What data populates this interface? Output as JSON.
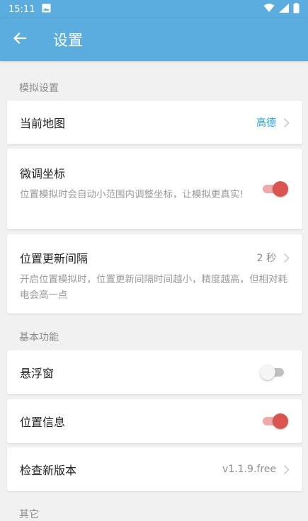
{
  "status_bar": {
    "time": "15:11"
  },
  "app_bar": {
    "title": "设置"
  },
  "sections": {
    "simulation": "模拟设置",
    "basic": "基本功能",
    "other": "其它"
  },
  "settings": {
    "current_map": {
      "title": "当前地图",
      "value": "高德"
    },
    "fine_tune": {
      "title": "微调坐标",
      "desc": "位置模拟时会自动小范围内调整坐标，让模拟更真实!",
      "enabled": true
    },
    "update_interval": {
      "title": "位置更新间隔",
      "value": "2 秒",
      "desc": "开启位置模拟时，位置更新间隔时间越小，精度越高，但相对耗电会高一点"
    },
    "floating_window": {
      "title": "悬浮窗",
      "enabled": false
    },
    "location_info": {
      "title": "位置信息",
      "enabled": true
    },
    "check_update": {
      "title": "检查新版本",
      "value": "v1.1.9.free"
    }
  },
  "colors": {
    "primary": "#5aadde",
    "accent_text": "#1a9be0",
    "toggle_on": "#d9534f"
  },
  "icons": {
    "back": "arrow-left-icon",
    "chevron": "chevron-right-icon",
    "wifi": "wifi-icon",
    "signal": "signal-icon",
    "battery": "battery-icon",
    "image": "image-icon"
  }
}
